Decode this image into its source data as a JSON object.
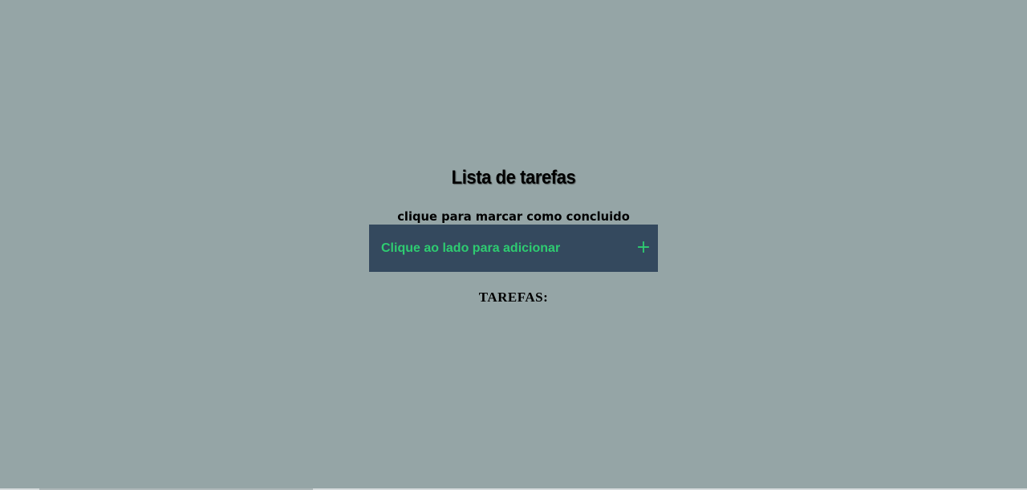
{
  "header": {
    "title": "Lista de tarefas",
    "subtitle": "clique para marcar como concluido"
  },
  "add_task": {
    "placeholder": "Clique ao lado para adicionar",
    "value": "",
    "button_label": "+"
  },
  "tasks": {
    "heading": "TAREFAS:",
    "items": []
  },
  "colors": {
    "background": "#95a5a6",
    "input_bar": "#34495e",
    "accent": "#2ecc71"
  }
}
